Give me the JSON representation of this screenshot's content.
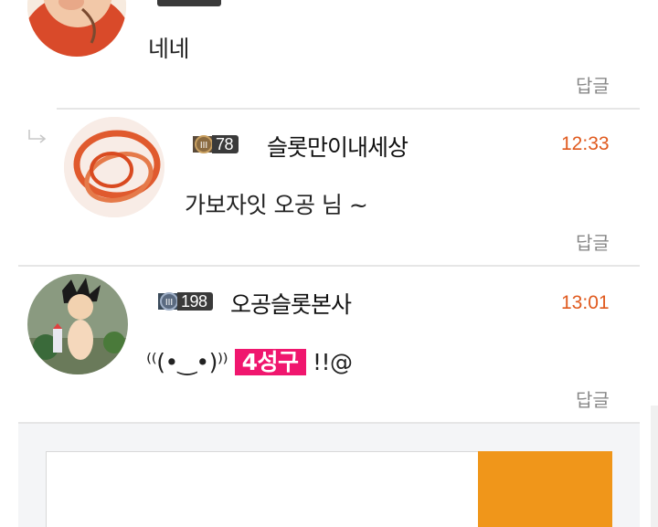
{
  "comments": [
    {
      "message": "네네",
      "reply_label": "답글"
    },
    {
      "is_reply": true,
      "level": "78",
      "nickname": "슬롯만이내세상",
      "time": "12:33",
      "message": "가보자잇 오공 님 ~",
      "reply_label": "답글"
    },
    {
      "level": "198",
      "nickname": "오공슬롯본사",
      "time": "13:01",
      "message_prefix": "⁽⁽(•‿•)⁾⁾",
      "message_highlight": "4성구",
      "message_suffix": "!!@",
      "reply_label": "답글"
    }
  ],
  "colors": {
    "time": "#e05a1e",
    "highlight": "#f0166e",
    "submit": "#f0961a"
  },
  "icons": [
    "reply-arrow-icon",
    "level-emblem-icon"
  ]
}
